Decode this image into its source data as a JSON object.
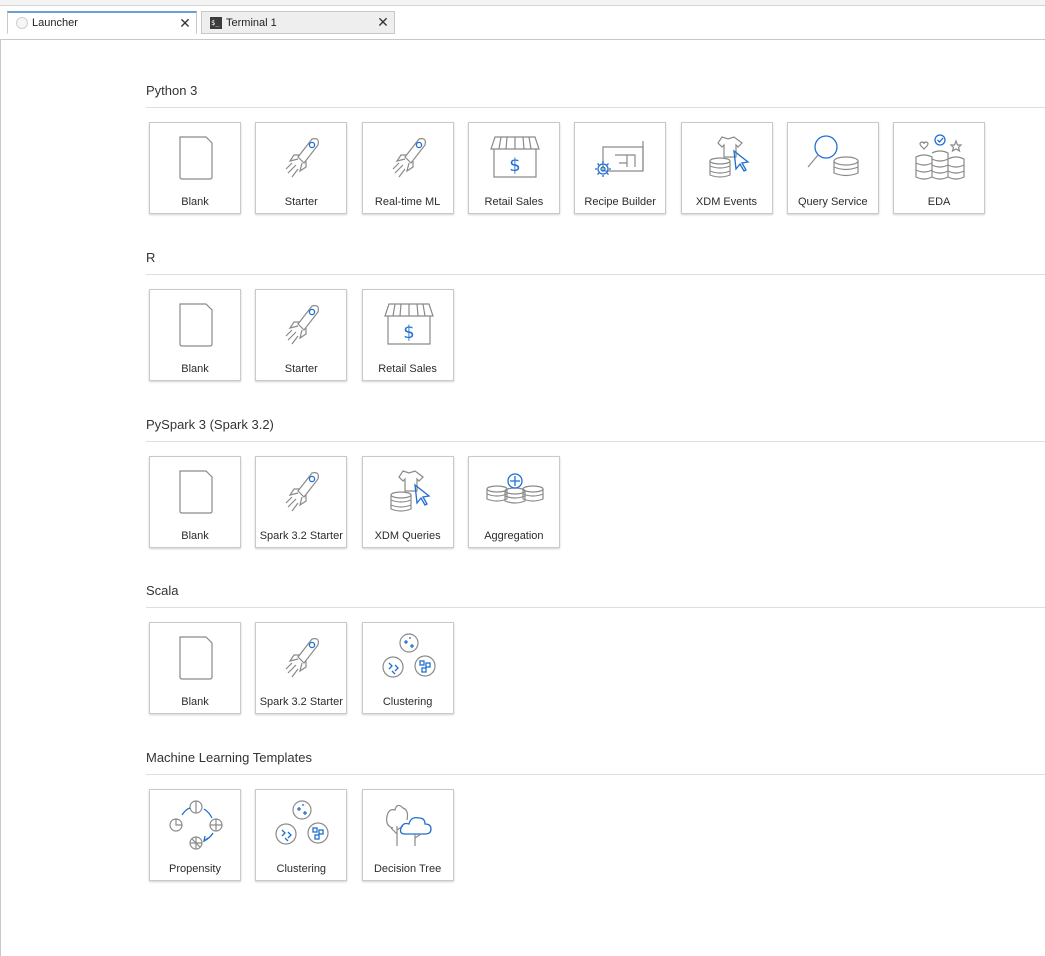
{
  "tabs": [
    {
      "label": "Launcher",
      "icon": "launcher-icon",
      "active": true
    },
    {
      "label": "Terminal 1",
      "icon": "terminal-icon",
      "active": false
    }
  ],
  "sections": [
    {
      "title": "Python 3",
      "cards": [
        {
          "label": "Blank",
          "icon": "blank-notebook-icon"
        },
        {
          "label": "Starter",
          "icon": "rocket-icon"
        },
        {
          "label": "Real-time ML",
          "icon": "rocket-icon"
        },
        {
          "label": "Retail Sales",
          "icon": "storefront-icon"
        },
        {
          "label": "Recipe Builder",
          "icon": "blueprint-gear-icon"
        },
        {
          "label": "XDM Events",
          "icon": "shirt-cursor-icon"
        },
        {
          "label": "Query Service",
          "icon": "magnifier-data-icon"
        },
        {
          "label": "EDA",
          "icon": "coins-check-icon"
        }
      ]
    },
    {
      "title": "R",
      "cards": [
        {
          "label": "Blank",
          "icon": "blank-notebook-icon"
        },
        {
          "label": "Starter",
          "icon": "rocket-icon"
        },
        {
          "label": "Retail Sales",
          "icon": "storefront-icon"
        }
      ]
    },
    {
      "title": "PySpark 3 (Spark 3.2)",
      "cards": [
        {
          "label": "Blank",
          "icon": "blank-notebook-icon"
        },
        {
          "label": "Spark 3.2 Starter",
          "icon": "rocket-icon"
        },
        {
          "label": "XDM Queries",
          "icon": "shirt-cursor-icon"
        },
        {
          "label": "Aggregation",
          "icon": "coins-plus-icon"
        }
      ]
    },
    {
      "title": "Scala",
      "cards": [
        {
          "label": "Blank",
          "icon": "blank-notebook-icon"
        },
        {
          "label": "Spark 3.2 Starter",
          "icon": "rocket-icon"
        },
        {
          "label": "Clustering",
          "icon": "clustering-icon"
        }
      ]
    },
    {
      "title": "Machine Learning Templates",
      "cards": [
        {
          "label": "Propensity",
          "icon": "cycle-icon"
        },
        {
          "label": "Clustering",
          "icon": "clustering-icon"
        },
        {
          "label": "Decision Tree",
          "icon": "tree-cloud-icon"
        }
      ]
    }
  ],
  "colors": {
    "accent": "#1f6fd1",
    "icon_gray": "#8a8a8a",
    "tab_active_border": "#6aa0d8"
  }
}
